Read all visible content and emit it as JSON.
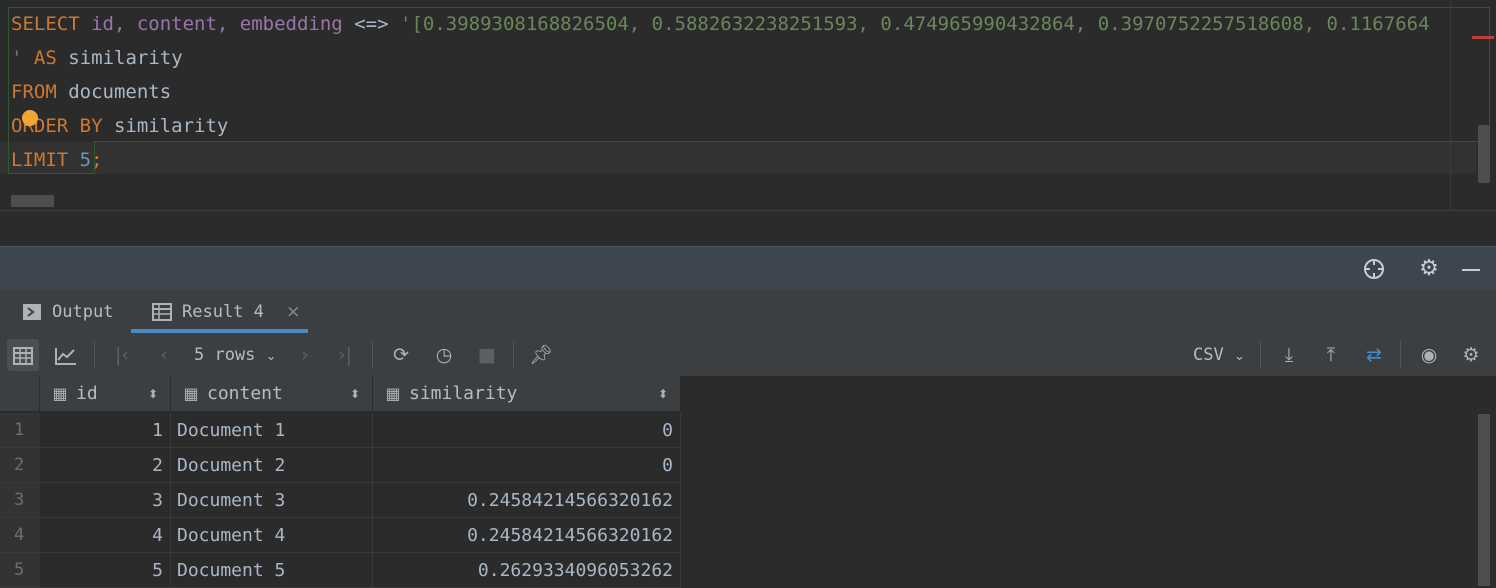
{
  "editor": {
    "line1": {
      "kw_select": "SELECT",
      "cols": "id, content, embedding",
      "op": "<=>",
      "vector": "'[0.3989308168826504, 0.5882632238251593, 0.474965990432864, 0.3970752257518608, 0.1167664"
    },
    "line2": {
      "quote": "'",
      "kw_as": "AS",
      "alias": "similarity"
    },
    "line3": {
      "kw_from": "FROM",
      "table": "documents"
    },
    "line4": {
      "kw_order": "ORDER BY",
      "col": "similarity"
    },
    "line5": {
      "kw_limit": "LIMIT",
      "num": "5",
      "semi": ";"
    }
  },
  "panel_header": {
    "icons": [
      "crosshair-icon",
      "gear-icon",
      "minimize-icon"
    ]
  },
  "tabs": [
    {
      "label": "Output",
      "icon": "console-icon"
    },
    {
      "label": "Result 4",
      "icon": "table-icon",
      "active": true,
      "close": "×"
    }
  ],
  "grid_toolbar": {
    "rows_label": "5 rows",
    "export_format": "CSV"
  },
  "columns": [
    {
      "label": "id",
      "icon": "column-icon"
    },
    {
      "label": "content",
      "icon": "column-icon"
    },
    {
      "label": "similarity",
      "icon": "column-icon"
    }
  ],
  "rows": [
    {
      "n": "1",
      "id": "1",
      "content": "Document 1",
      "similarity": "0"
    },
    {
      "n": "2",
      "id": "2",
      "content": "Document 2",
      "similarity": "0"
    },
    {
      "n": "3",
      "id": "3",
      "content": "Document 3",
      "similarity": "0.24584214566320162"
    },
    {
      "n": "4",
      "id": "4",
      "content": "Document 4",
      "similarity": "0.24584214566320162"
    },
    {
      "n": "5",
      "id": "5",
      "content": "Document 5",
      "similarity": "0.2629334096053262"
    }
  ],
  "colors": {
    "keyword": "#cc7832",
    "column": "#9876aa",
    "string": "#6a8759",
    "number": "#6897bb",
    "accent": "#4a88c7"
  }
}
